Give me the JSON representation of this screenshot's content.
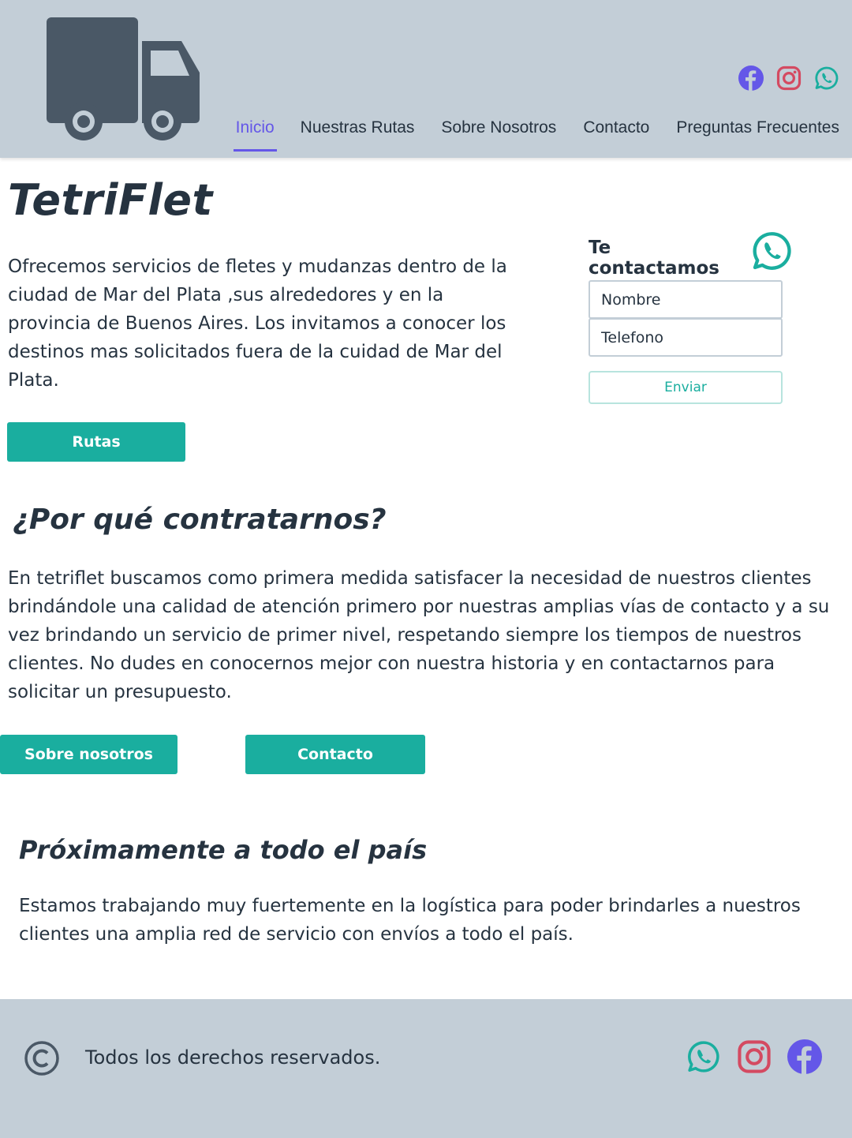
{
  "header": {
    "logo_icon": "truck-icon",
    "social": [
      {
        "name": "facebook-icon",
        "color": "#6457e8"
      },
      {
        "name": "instagram-icon",
        "color": "#d44a61"
      },
      {
        "name": "whatsapp-icon",
        "color": "#1aae9f"
      }
    ],
    "nav": [
      {
        "label": "Inicio",
        "active": true
      },
      {
        "label": "Nuestras Rutas",
        "active": false
      },
      {
        "label": "Sobre Nosotros",
        "active": false
      },
      {
        "label": "Contacto",
        "active": false
      },
      {
        "label": "Preguntas Frecuentes",
        "active": false
      }
    ]
  },
  "hero": {
    "title": "TetriFlet",
    "text": "Ofrecemos servicios de fletes y mudanzas dentro de la ciudad de Mar del Plata ,sus alrededores y en la provincia de Buenos Aires. Los invitamos a conocer los destinos mas solicitados fuera de la cuidad de Mar del Plata.",
    "button": "Rutas"
  },
  "contact_form": {
    "title": "Te contactamos",
    "name_placeholder": "Nombre",
    "phone_placeholder": "Telefono",
    "send_label": "Enviar"
  },
  "why": {
    "title": "¿Por qué contratarnos?",
    "text": "En tetriflet buscamos como primera medida satisfacer la necesidad de nuestros clientes brindándole una calidad de atención primero por nuestras amplias vías de contacto y a su vez brindando un servicio de primer nivel, respetando siempre los tiempos de nuestros clientes. No dudes en conocernos mejor con nuestra historia y en contactarnos para solicitar un presupuesto.",
    "about_button": "Sobre nosotros",
    "contact_button": "Contacto"
  },
  "soon": {
    "title": "Próximamente a todo el país",
    "text": "Estamos trabajando muy fuertemente en la logística para poder brindarles a nuestros clientes una amplia red de servicio con envíos a todo el país."
  },
  "footer": {
    "copyright_icon": "copyright-icon",
    "text": "Todos los derechos reservados.",
    "social": [
      "whatsapp-icon",
      "instagram-icon",
      "facebook-icon"
    ]
  },
  "colors": {
    "header_bg": "#c3ced7",
    "accent_green": "#1aae9f",
    "nav_active": "#6457e8",
    "text_dark": "#263340",
    "logo_gray": "#4a5866"
  }
}
